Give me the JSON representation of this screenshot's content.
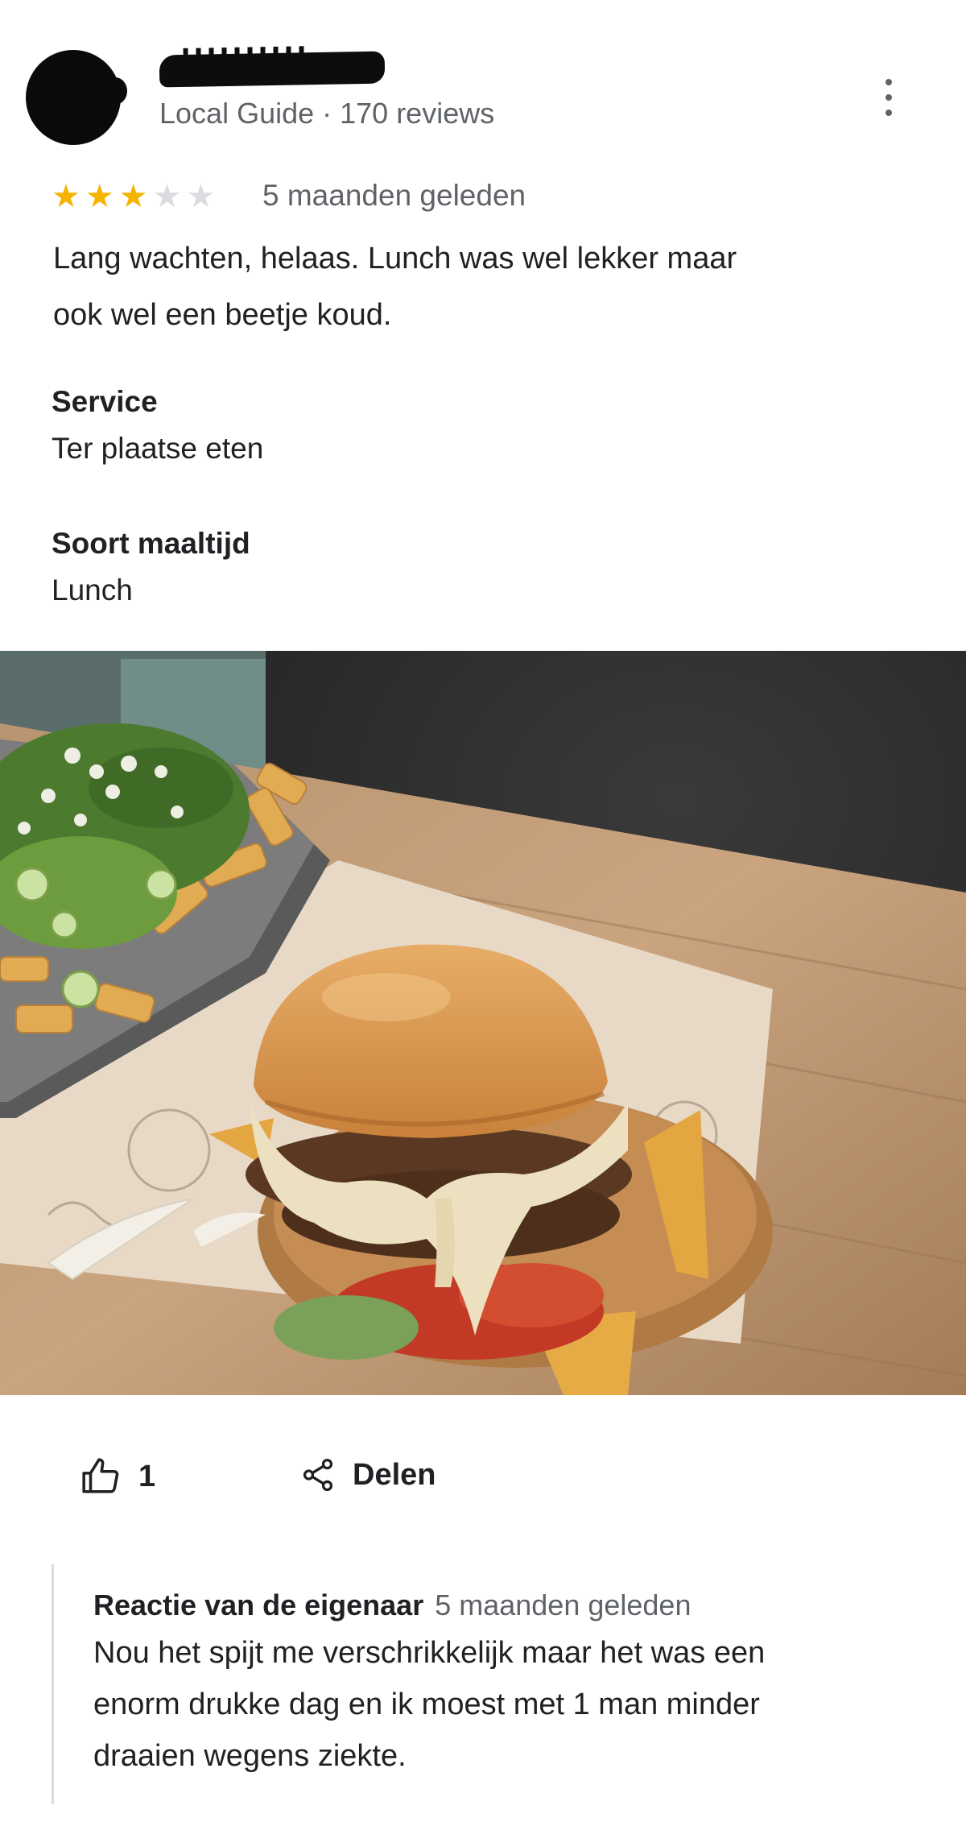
{
  "review": {
    "reviewer_meta": "Local Guide · 170 reviews",
    "rating": 3,
    "rating_max": 5,
    "time": "5 maanden geleden",
    "text_line1": "Lang wachten, helaas. Lunch was wel lekker maar",
    "text_line2": "ook wel een beetje koud.",
    "attributes": [
      {
        "label": "Service",
        "value": "Ter plaatse eten"
      },
      {
        "label": "Soort maaltijd",
        "value": "Lunch"
      }
    ]
  },
  "actions": {
    "like_count": "1",
    "share_label": "Delen"
  },
  "owner_reply": {
    "title": "Reactie van de eigenaar",
    "time": "5 maanden geleden",
    "line1": "Nou het spijt me verschrikkelijk maar het was een",
    "line2": "enorm drukke dag en ik moest met 1 man minder",
    "line3": "draaien wegens ziekte."
  },
  "colors": {
    "star_filled": "#f4b400",
    "star_empty": "#dadce0",
    "secondary_text": "#5f6368"
  },
  "icons": [
    "more-vert-icon",
    "thumb-up-icon",
    "share-icon"
  ]
}
